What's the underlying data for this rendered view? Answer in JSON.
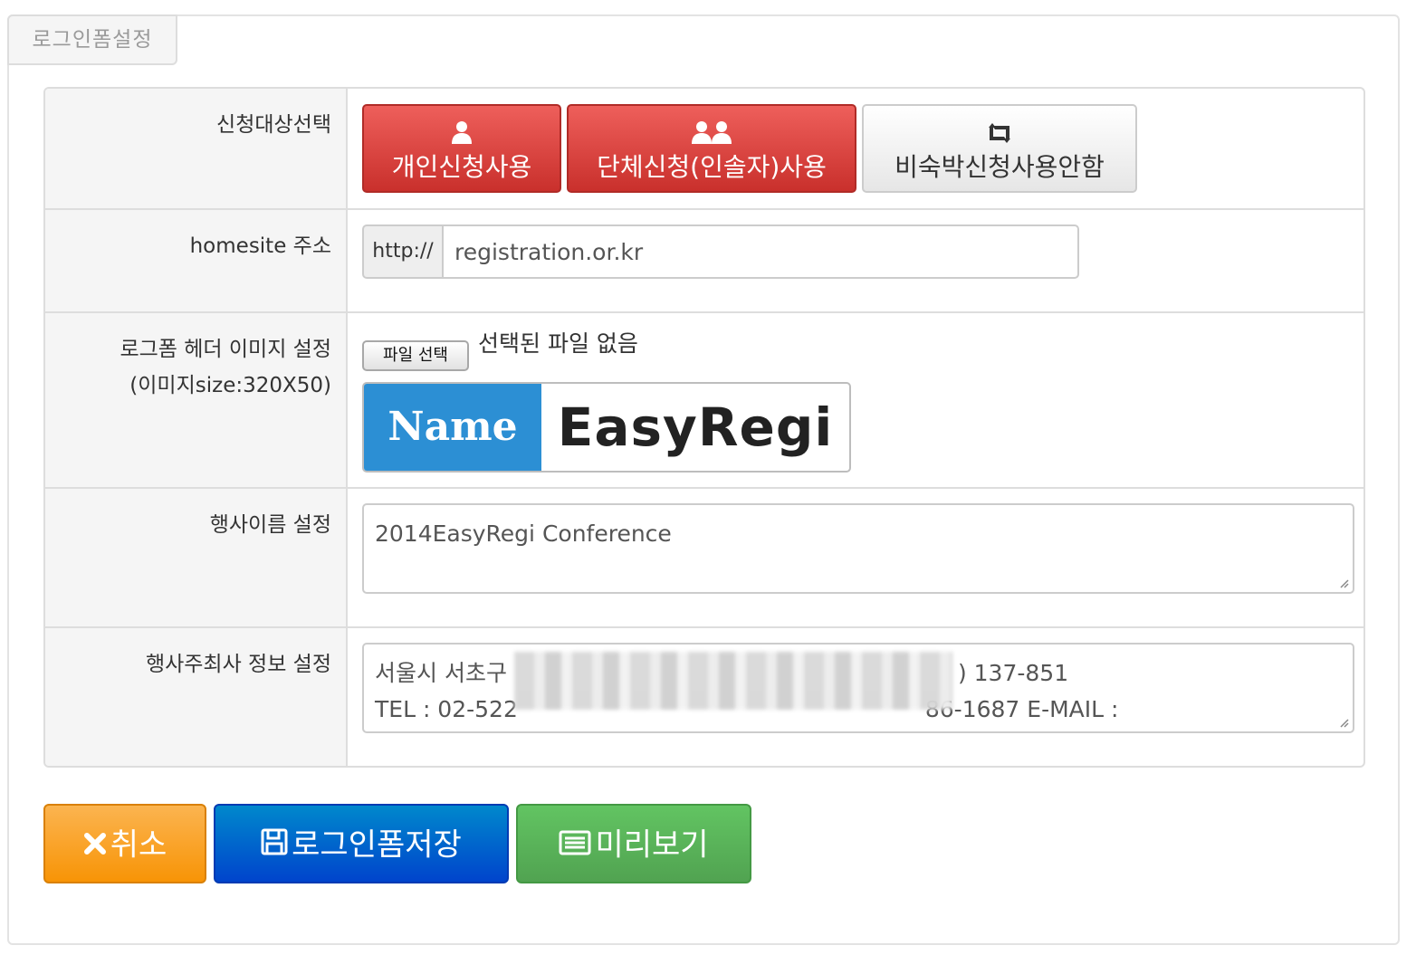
{
  "panel": {
    "tab_label": "로그인폼설정"
  },
  "rows": {
    "target": {
      "label": "신청대상선택",
      "buttons": [
        {
          "label": "개인신청사용",
          "icon": "user-icon",
          "state": "active"
        },
        {
          "label": "단체신청(인솔자)사용",
          "icon": "group-icon",
          "state": "active"
        },
        {
          "label": "비숙박신청사용안함",
          "icon": "retweet-icon",
          "state": "inactive"
        }
      ]
    },
    "homesite": {
      "label": "homesite 주소",
      "prefix": "http://",
      "value": "registration.or.kr"
    },
    "header_image": {
      "label_line1": "로그폼 헤더 이미지 설정",
      "label_line2": "(이미지size:320X50)",
      "file_button": "파일 선택",
      "file_status": "선택된 파일 없음",
      "logo_left": "Name",
      "logo_right": "EasyRegi"
    },
    "event_name": {
      "label": "행사이름 설정",
      "value": "2014EasyRegi Conference"
    },
    "organizer": {
      "label": "행사주최사 정보 설정",
      "line1_start": "서울시 서초구",
      "line1_end": ") 137-851",
      "line2_start": "TEL : 02-522",
      "line2_end": "86-1687   E-MAIL :"
    }
  },
  "actions": {
    "cancel": "취소",
    "save": "로그인폼저장",
    "preview": "미리보기"
  },
  "colors": {
    "red_button": "#d9534f",
    "orange_button": "#f89406",
    "blue_button": "#0055cc",
    "green_button": "#51a351",
    "logo_blue": "#2c8fd4"
  }
}
